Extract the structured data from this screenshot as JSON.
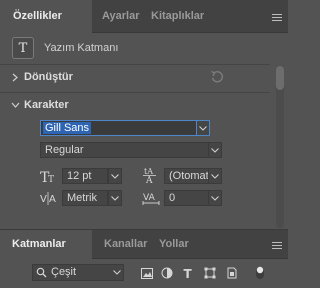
{
  "properties_panel": {
    "tabs": [
      {
        "label": "Özellikler",
        "active": true
      },
      {
        "label": "Ayarlar",
        "active": false
      },
      {
        "label": "Kitaplıklar",
        "active": false
      }
    ],
    "layer_type": {
      "icon": "T",
      "label": "Yazım Katmanı"
    },
    "transform": {
      "label": "Dönüştür",
      "expanded": false
    },
    "character": {
      "label": "Karakter",
      "expanded": true,
      "font_family": "Gill Sans",
      "font_style": "Regular",
      "font_size": "12 pt",
      "leading": "(Otomatik)",
      "kerning": "Metrik",
      "tracking": "0"
    }
  },
  "layers_panel": {
    "tabs": [
      {
        "label": "Katmanlar",
        "active": true
      },
      {
        "label": "Kanallar",
        "active": false
      },
      {
        "label": "Yollar",
        "active": false
      }
    ],
    "filter": {
      "label": "Çeşit"
    }
  },
  "colors": {
    "panel_bg": "#535353",
    "tab_bar_bg": "#424242",
    "field_bg": "#454545",
    "accent_focus": "#4f86c9",
    "selection": "#2d64b4"
  }
}
